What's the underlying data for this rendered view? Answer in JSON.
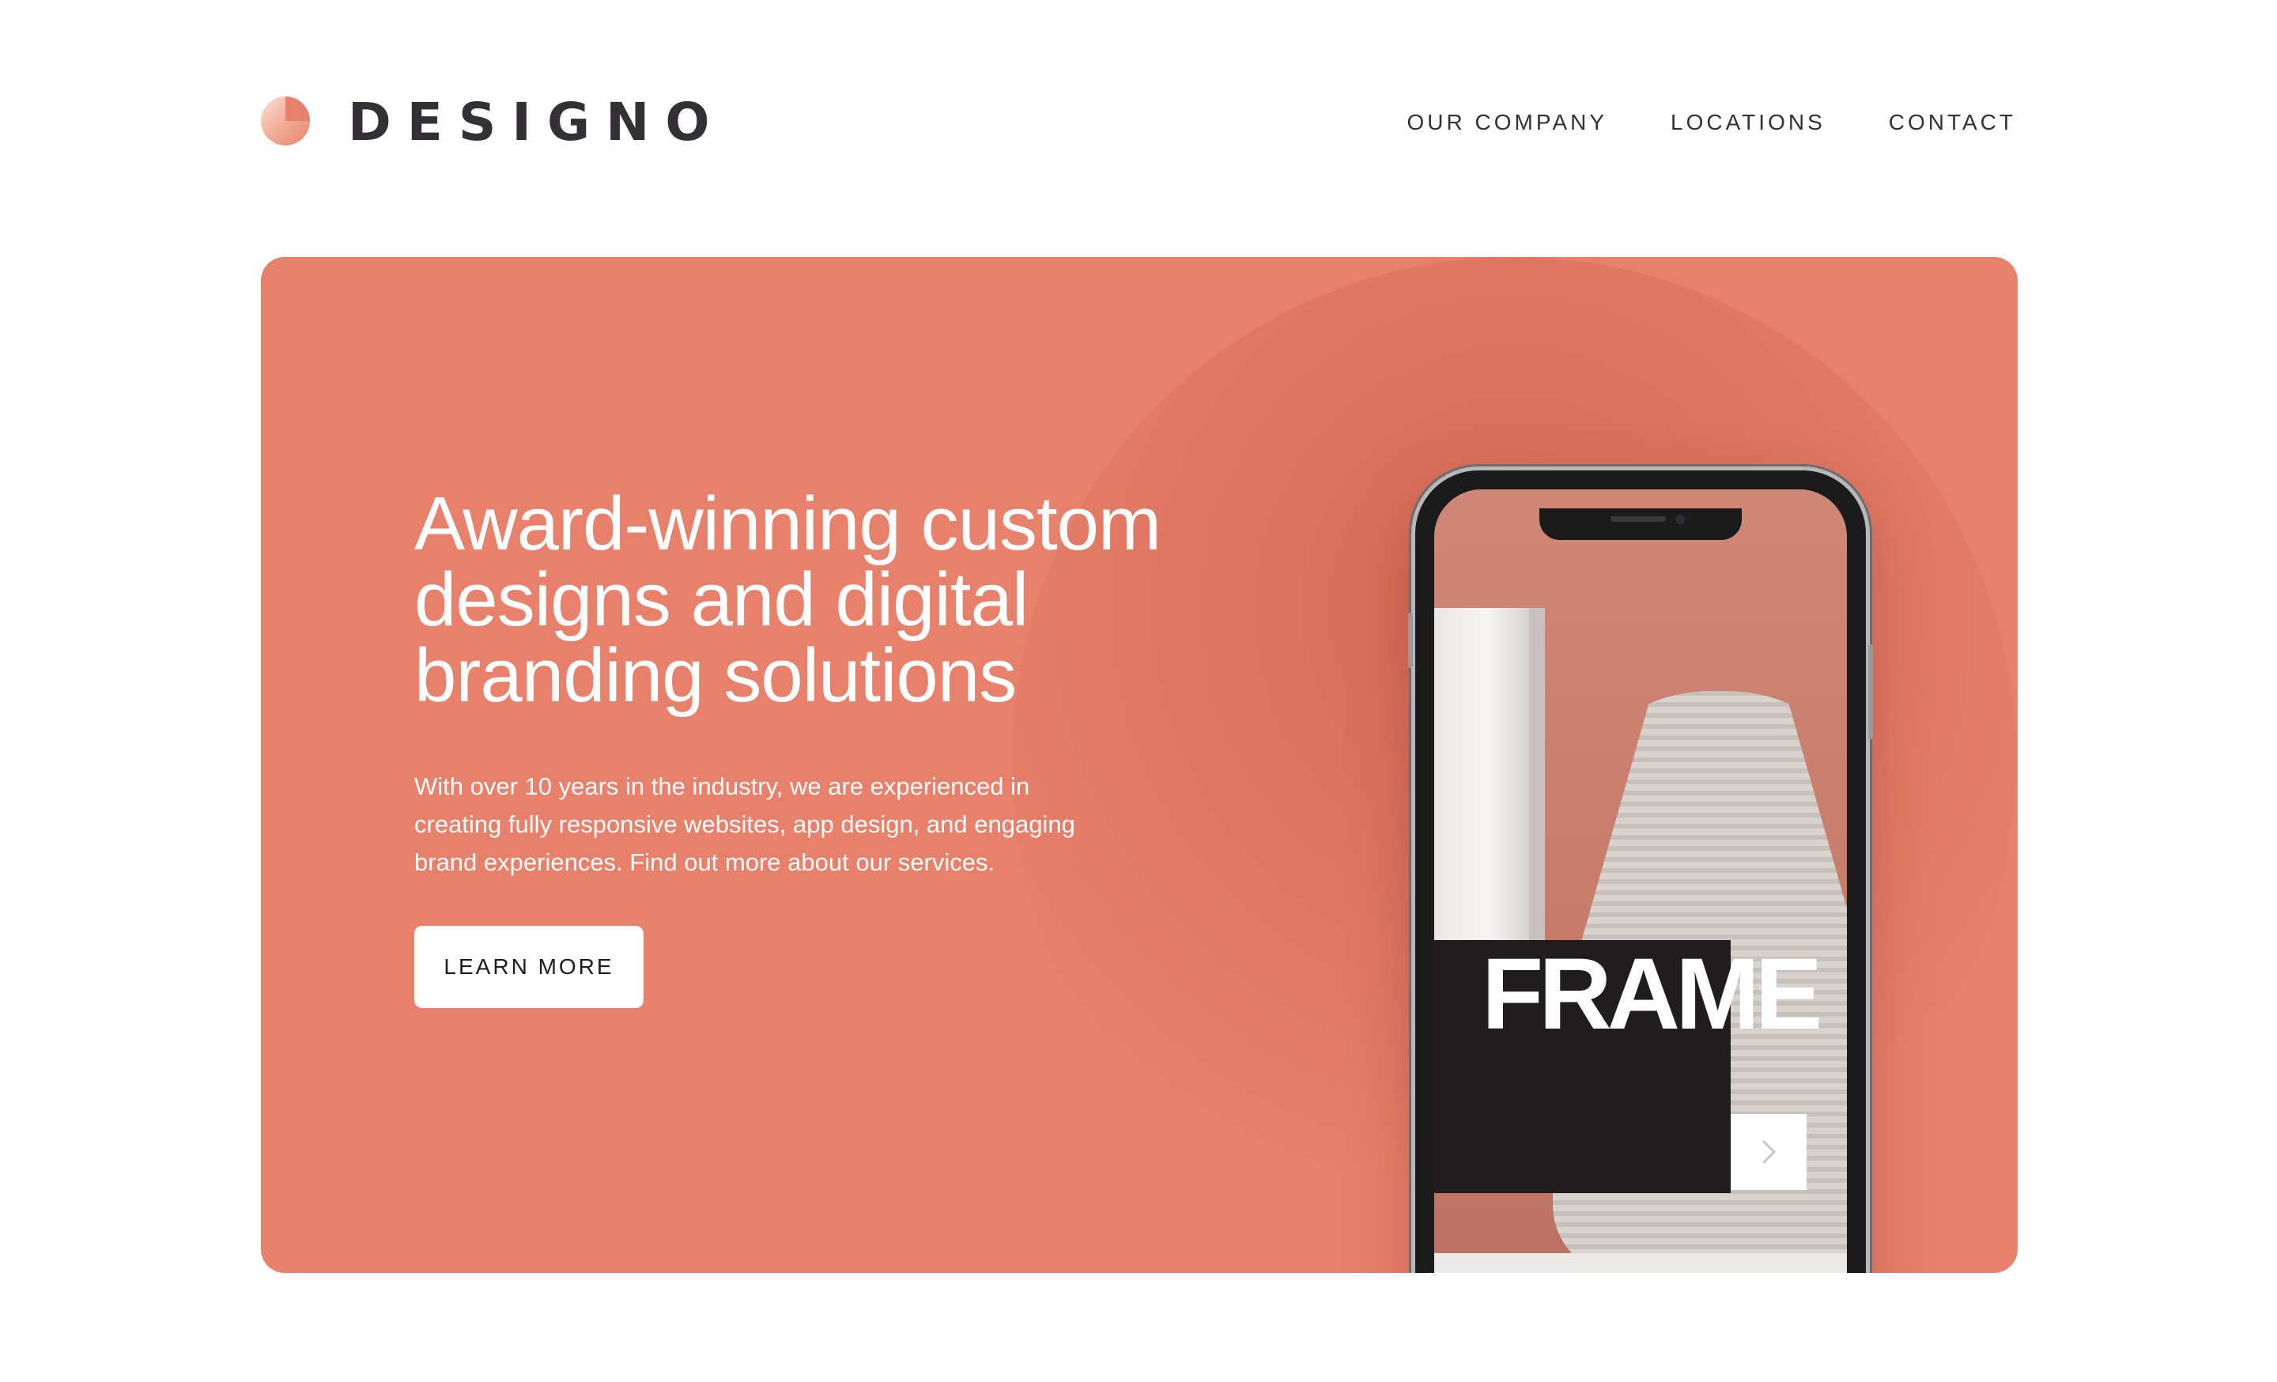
{
  "header": {
    "logo_text": "DESIGNO",
    "nav": [
      "OUR COMPANY",
      "LOCATIONS",
      "CONTACT"
    ]
  },
  "hero": {
    "title_lines": [
      "Award-winning custom",
      "designs and digital",
      "branding solutions"
    ],
    "description": "With over 10 years in the industry, we are experienced in creating fully responsive websites, app design, and engaging brand experiences. Find out more about our services.",
    "cta_label": "LEARN MORE",
    "phone_screen_text": "FRAME"
  },
  "colors": {
    "brand_peach": "#e7816b",
    "text_dark": "#333136",
    "white": "#ffffff"
  },
  "icons": {
    "logo": "logo-mark-icon",
    "next": "chevron-right-icon"
  }
}
